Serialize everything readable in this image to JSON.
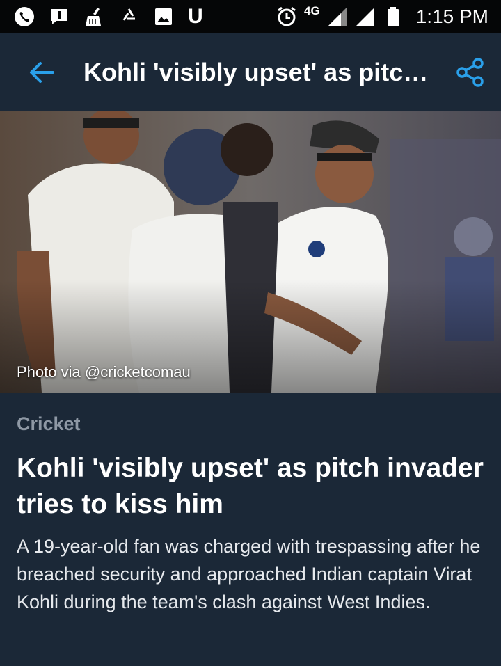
{
  "status_bar": {
    "network": "4G",
    "time": "1:15 PM",
    "left_icons": [
      "phone-icon",
      "chat-alert-icon",
      "cleaner-icon",
      "recycle-icon",
      "image-icon"
    ],
    "u_glyph": "U"
  },
  "app_bar": {
    "title": "Kohli 'visibly upset' as pitch invader tries to kiss him",
    "back_icon": "arrow-left-icon",
    "share_icon": "share-icon"
  },
  "hero": {
    "caption": "Photo via @cricketcomau"
  },
  "article": {
    "category": "Cricket",
    "headline": "Kohli 'visibly upset' as pitch invader tries to kiss him",
    "summary": "A 19-year-old fan was charged with trespassing after he breached security and approached Indian captain Virat Kohli during the team's clash against West Indies."
  },
  "colors": {
    "background": "#1b2837",
    "status_bar": "#050607",
    "accent_blue": "#2aa0ea",
    "category_gray": "#8e98a4"
  }
}
